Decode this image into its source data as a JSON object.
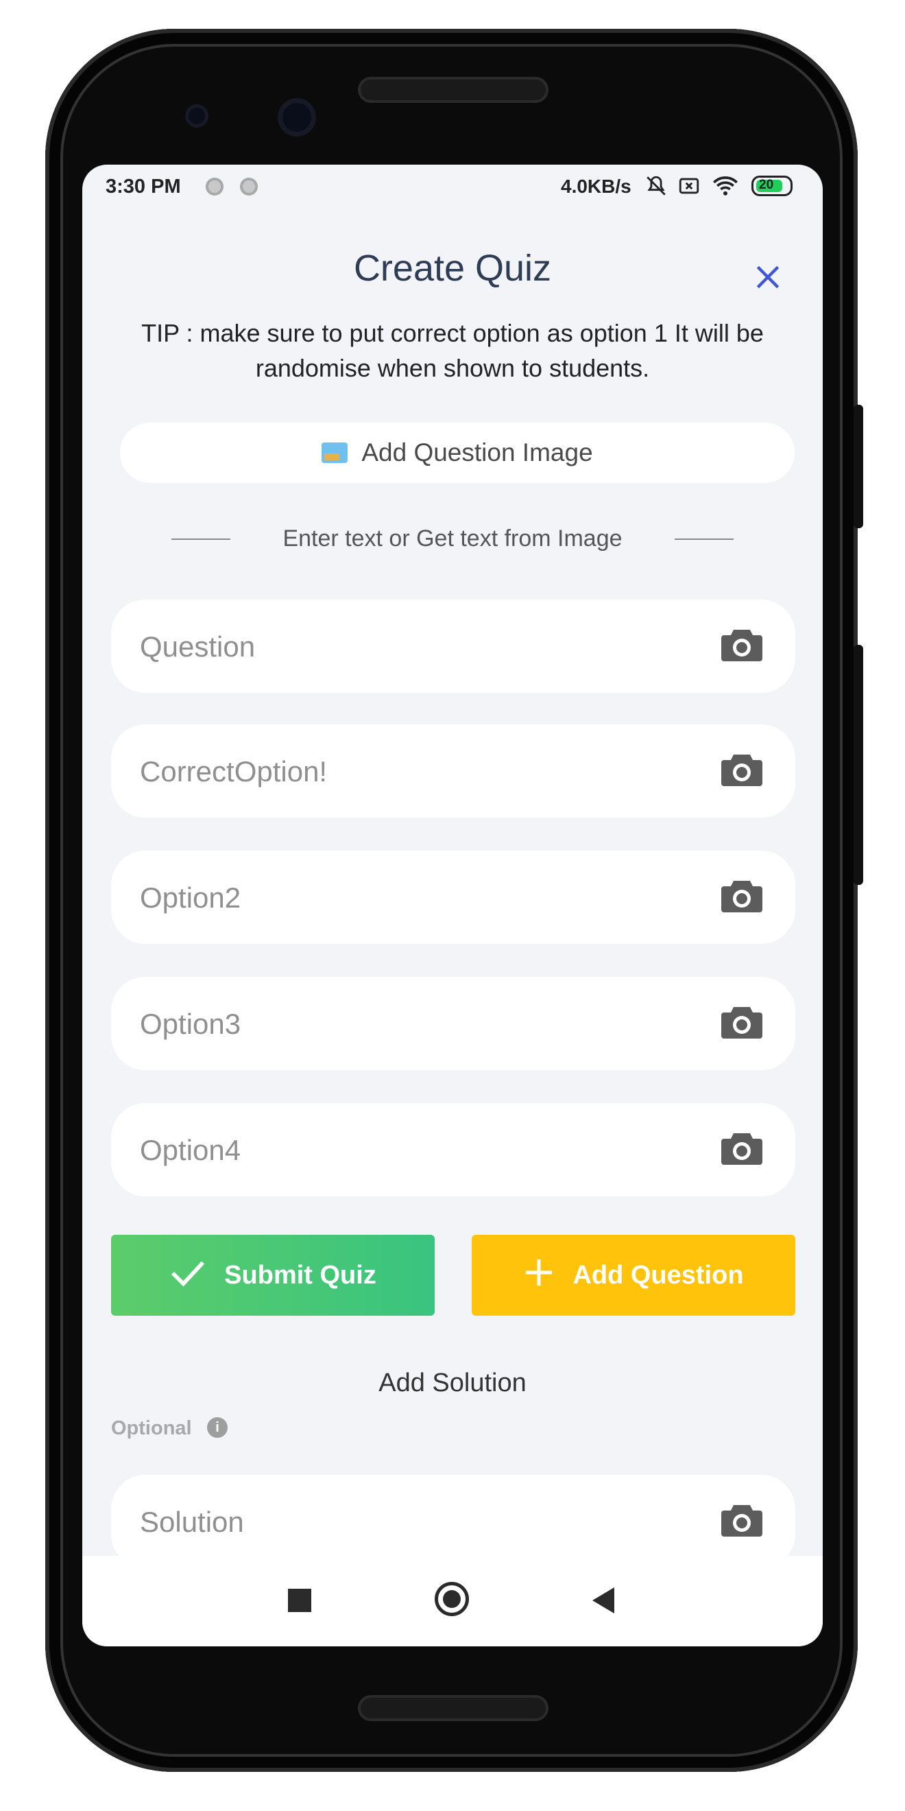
{
  "status_bar": {
    "time": "3:30 PM",
    "speed": "4.0KB/s",
    "battery": "20"
  },
  "header": {
    "title": "Create Quiz",
    "close_icon": "close-icon",
    "tip": "TIP : make sure to put correct option as option 1 It will be randomise when shown to students."
  },
  "add_image": {
    "label": "Add Question Image",
    "icon": "image-icon"
  },
  "divider_text": "Enter text or Get text from Image",
  "fields": {
    "question": {
      "placeholder": "Question",
      "value": ""
    },
    "correct_option": {
      "placeholder": "CorrectOption!",
      "value": ""
    },
    "option2": {
      "placeholder": "Option2",
      "value": ""
    },
    "option3": {
      "placeholder": "Option3",
      "value": ""
    },
    "option4": {
      "placeholder": "Option4",
      "value": ""
    },
    "solution": {
      "placeholder": "Solution",
      "value": ""
    }
  },
  "buttons": {
    "submit_label": "Submit Quiz",
    "add_question_label": "Add Question",
    "submit_color": "#4cc974",
    "add_color": "#fec30a"
  },
  "solution_section": {
    "title": "Add Solution",
    "optional": "Optional"
  },
  "colors": {
    "accent": "#3f56d6",
    "background": "#f3f4f8"
  }
}
